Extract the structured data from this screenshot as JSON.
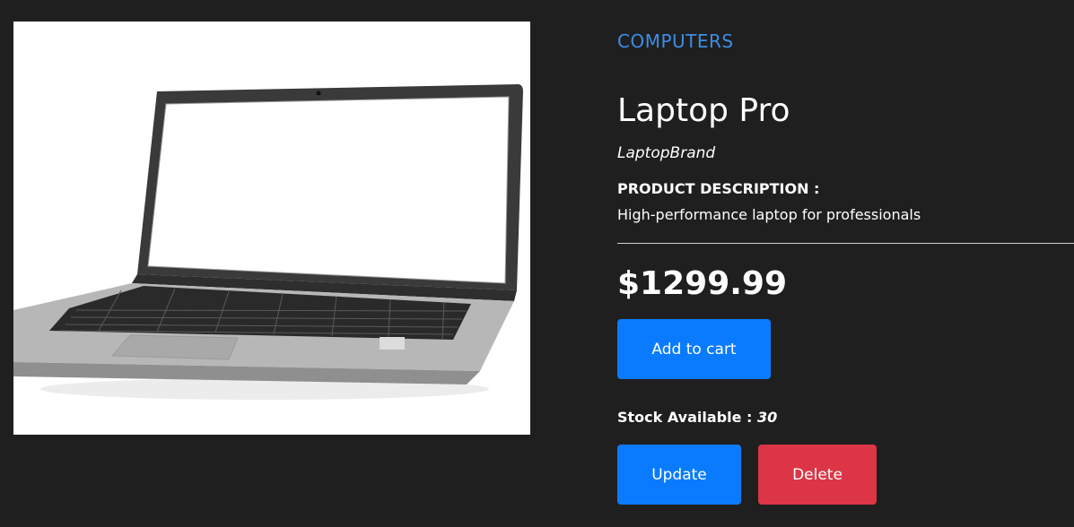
{
  "product": {
    "category": "COMPUTERS",
    "name": "Laptop Pro",
    "brand": "LaptopBrand",
    "description_heading": "PRODUCT DESCRIPTION :",
    "description": "High-performance laptop for professionals",
    "price": "$1299.99",
    "image_alt": "laptop product photo"
  },
  "actions": {
    "add_to_cart": "Add to cart",
    "update": "Update",
    "delete": "Delete"
  },
  "stock": {
    "label": "Stock Available : ",
    "value": "30"
  },
  "colors": {
    "background": "#1f1f1f",
    "accent": "#3d8ee3",
    "primary_button": "#0a7bff",
    "danger_button": "#dc3545"
  }
}
